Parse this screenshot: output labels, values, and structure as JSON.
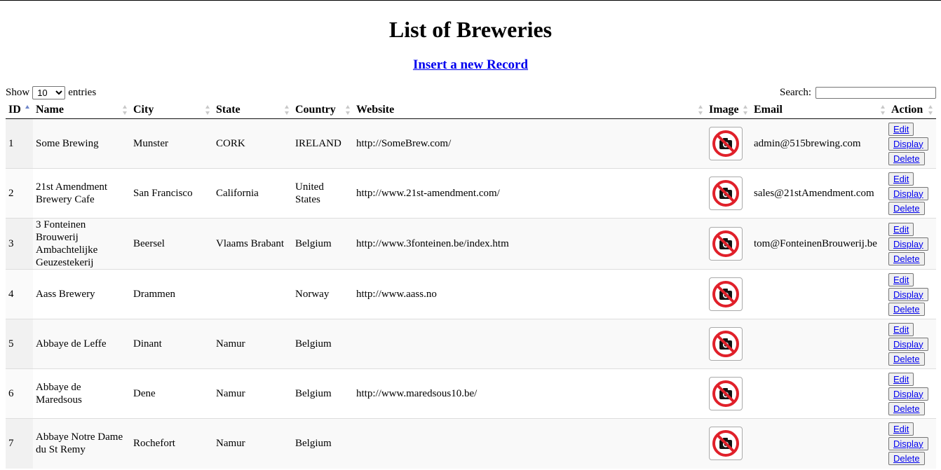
{
  "page": {
    "title": "List of Breweries",
    "insert_link": "Insert a new Record"
  },
  "controls": {
    "show_label": "Show",
    "entries_label": "entries",
    "page_length": "10",
    "search_label": "Search:",
    "search_value": ""
  },
  "table": {
    "columns": [
      "ID",
      "Name",
      "City",
      "State",
      "Country",
      "Website",
      "Image",
      "Email",
      "Action"
    ],
    "sorted_column": "ID",
    "sort_direction": "ascending",
    "rows": [
      {
        "id": "1",
        "name": "Some Brewing",
        "city": "Munster",
        "state": "CORK",
        "country": "IRELAND",
        "website": "http://SomeBrew.com/",
        "email": "admin@515brewing.com"
      },
      {
        "id": "2",
        "name": "21st Amendment Brewery Cafe",
        "city": "San Francisco",
        "state": "California",
        "country": "United States",
        "website": "http://www.21st-amendment.com/",
        "email": "sales@21stAmendment.com"
      },
      {
        "id": "3",
        "name": "3 Fonteinen Brouwerij Ambachtelijke Geuzestekerij",
        "city": "Beersel",
        "state": "Vlaams Brabant",
        "country": "Belgium",
        "website": "http://www.3fonteinen.be/index.htm",
        "email": "tom@FonteinenBrouwerij.be"
      },
      {
        "id": "4",
        "name": "Aass Brewery",
        "city": "Drammen",
        "state": "",
        "country": "Norway",
        "website": "http://www.aass.no",
        "email": ""
      },
      {
        "id": "5",
        "name": "Abbaye de Leffe",
        "city": "Dinant",
        "state": "Namur",
        "country": "Belgium",
        "website": "",
        "email": ""
      },
      {
        "id": "6",
        "name": "Abbaye de Maredsous",
        "city": "Dene",
        "state": "Namur",
        "country": "Belgium",
        "website": "http://www.maredsous10.be/",
        "email": ""
      },
      {
        "id": "7",
        "name": "Abbaye Notre Dame du St Remy",
        "city": "Rochefort",
        "state": "Namur",
        "country": "Belgium",
        "website": "",
        "email": ""
      }
    ],
    "image_icon": "no-photo-icon",
    "actions": {
      "edit": "Edit",
      "display": "Display",
      "delete": "Delete"
    }
  },
  "colors": {
    "link": "#0000ee",
    "no_photo_red": "#e0202a",
    "sort_active": "#6f86c9"
  }
}
